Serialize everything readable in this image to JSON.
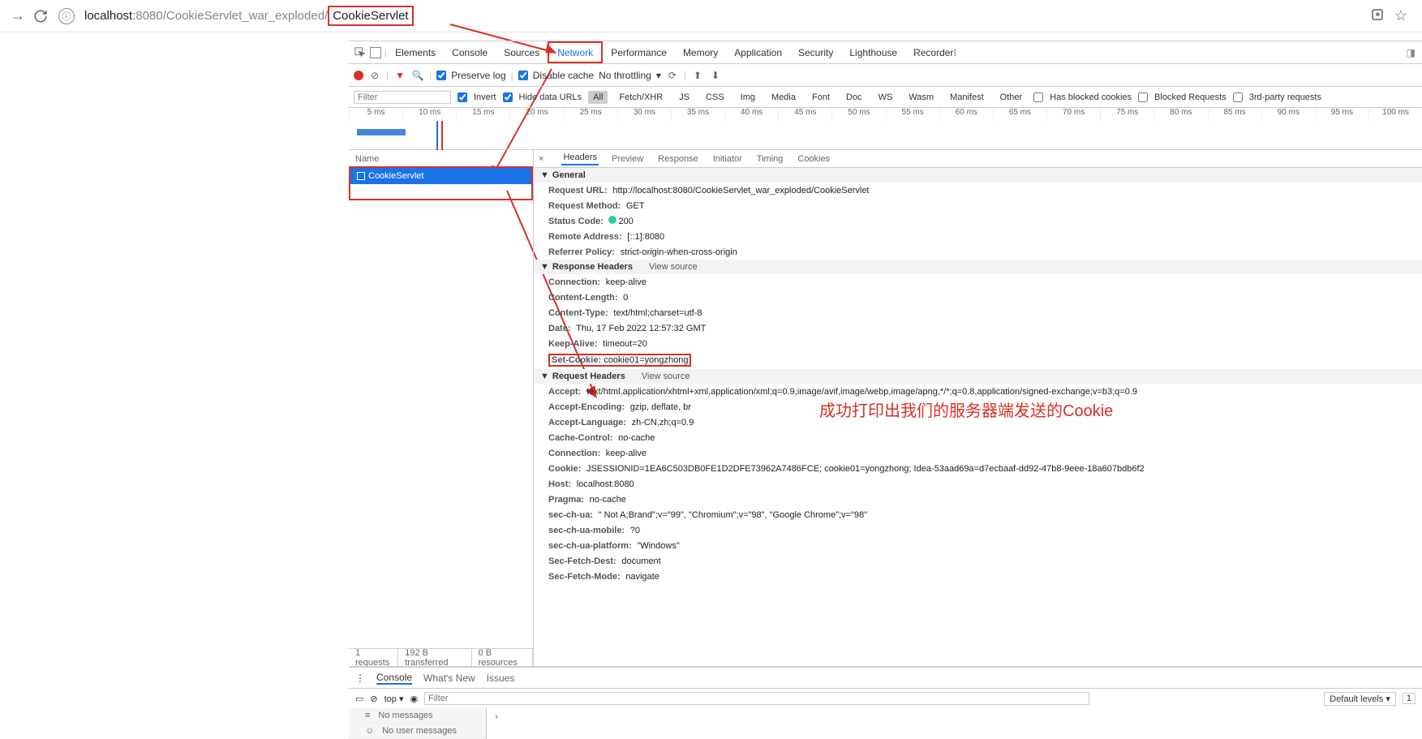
{
  "url": {
    "host": "localhost",
    "port": ":8080",
    "path": "/CookieServlet_war_exploded/",
    "servlet": "CookieServlet"
  },
  "devtools_tabs": [
    "Elements",
    "Console",
    "Sources",
    "Network",
    "Performance",
    "Memory",
    "Application",
    "Security",
    "Lighthouse",
    "Recorder"
  ],
  "active_dt_tab": "Network",
  "toolbar": {
    "preserve": "Preserve log",
    "disable_cache": "Disable cache",
    "throttling": "No throttling"
  },
  "filterbar": {
    "filter_ph": "Filter",
    "invert": "Invert",
    "hide": "Hide data URLs",
    "types": [
      "All",
      "Fetch/XHR",
      "JS",
      "CSS",
      "Img",
      "Media",
      "Font",
      "Doc",
      "WS",
      "Wasm",
      "Manifest",
      "Other"
    ],
    "blocked_cookies": "Has blocked cookies",
    "blocked_req": "Blocked Requests",
    "thirdparty": "3rd-party requests"
  },
  "timeline_ticks": [
    "5 ms",
    "10 ms",
    "15 ms",
    "20 ms",
    "25 ms",
    "30 ms",
    "35 ms",
    "40 ms",
    "45 ms",
    "50 ms",
    "55 ms",
    "60 ms",
    "65 ms",
    "70 ms",
    "75 ms",
    "80 ms",
    "85 ms",
    "90 ms",
    "95 ms",
    "100 ms"
  ],
  "reqlist": {
    "header": "Name",
    "row": "CookieServlet",
    "status": {
      "requests": "1 requests",
      "transferred": "192 B transferred",
      "resources": "0 B resources"
    }
  },
  "detail_tabs": [
    "Headers",
    "Preview",
    "Response",
    "Initiator",
    "Timing",
    "Cookies"
  ],
  "sections": {
    "general": {
      "title": "General",
      "rows": [
        {
          "k": "Request URL:",
          "v": "http://localhost:8080/CookieServlet_war_exploded/CookieServlet"
        },
        {
          "k": "Request Method:",
          "v": "GET"
        },
        {
          "k": "Status Code:",
          "v": "200",
          "dot": true
        },
        {
          "k": "Remote Address:",
          "v": "[::1]:8080"
        },
        {
          "k": "Referrer Policy:",
          "v": "strict-origin-when-cross-origin"
        }
      ]
    },
    "response": {
      "title": "Response Headers",
      "vs": "View source",
      "rows": [
        {
          "k": "Connection:",
          "v": "keep-alive"
        },
        {
          "k": "Content-Length:",
          "v": "0"
        },
        {
          "k": "Content-Type:",
          "v": "text/html;charset=utf-8"
        },
        {
          "k": "Date:",
          "v": "Thu, 17 Feb 2022 12:57:32 GMT"
        },
        {
          "k": "Keep-Alive:",
          "v": "timeout=20"
        },
        {
          "k": "Set-Cookie:",
          "v": "cookie01=yongzhong",
          "box": true
        }
      ]
    },
    "request": {
      "title": "Request Headers",
      "vs": "View source",
      "rows": [
        {
          "k": "Accept:",
          "v": "text/html,application/xhtml+xml,application/xml;q=0.9,image/avif,image/webp,image/apng,*/*;q=0.8,application/signed-exchange;v=b3;q=0.9"
        },
        {
          "k": "Accept-Encoding:",
          "v": "gzip, deflate, br"
        },
        {
          "k": "Accept-Language:",
          "v": "zh-CN,zh;q=0.9"
        },
        {
          "k": "Cache-Control:",
          "v": "no-cache"
        },
        {
          "k": "Connection:",
          "v": "keep-alive"
        },
        {
          "k": "Cookie:",
          "v": "JSESSIONID=1EA6C503DB0FE1D2DFE73962A7486FCE; cookie01=yongzhong; Idea-53aad69a=d7ecbaaf-dd92-47b8-9eee-18a607bdb6f2"
        },
        {
          "k": "Host:",
          "v": "localhost:8080"
        },
        {
          "k": "Pragma:",
          "v": "no-cache"
        },
        {
          "k": "sec-ch-ua:",
          "v": "\" Not A;Brand\";v=\"99\", \"Chromium\";v=\"98\", \"Google Chrome\";v=\"98\""
        },
        {
          "k": "sec-ch-ua-mobile:",
          "v": "?0"
        },
        {
          "k": "sec-ch-ua-platform:",
          "v": "\"Windows\""
        },
        {
          "k": "Sec-Fetch-Dest:",
          "v": "document"
        },
        {
          "k": "Sec-Fetch-Mode:",
          "v": "navigate"
        }
      ]
    }
  },
  "annotation": "成功打印出我们的服务器端发送的Cookie",
  "console": {
    "tabs": [
      "Console",
      "What's New",
      "Issues"
    ],
    "top": "top",
    "filter_ph": "Filter",
    "levels": "Default levels",
    "issue_badge": "1",
    "rows": [
      {
        "icon": "≡",
        "text": "No messages"
      },
      {
        "icon": "☺",
        "text": "No user messages"
      }
    ]
  }
}
